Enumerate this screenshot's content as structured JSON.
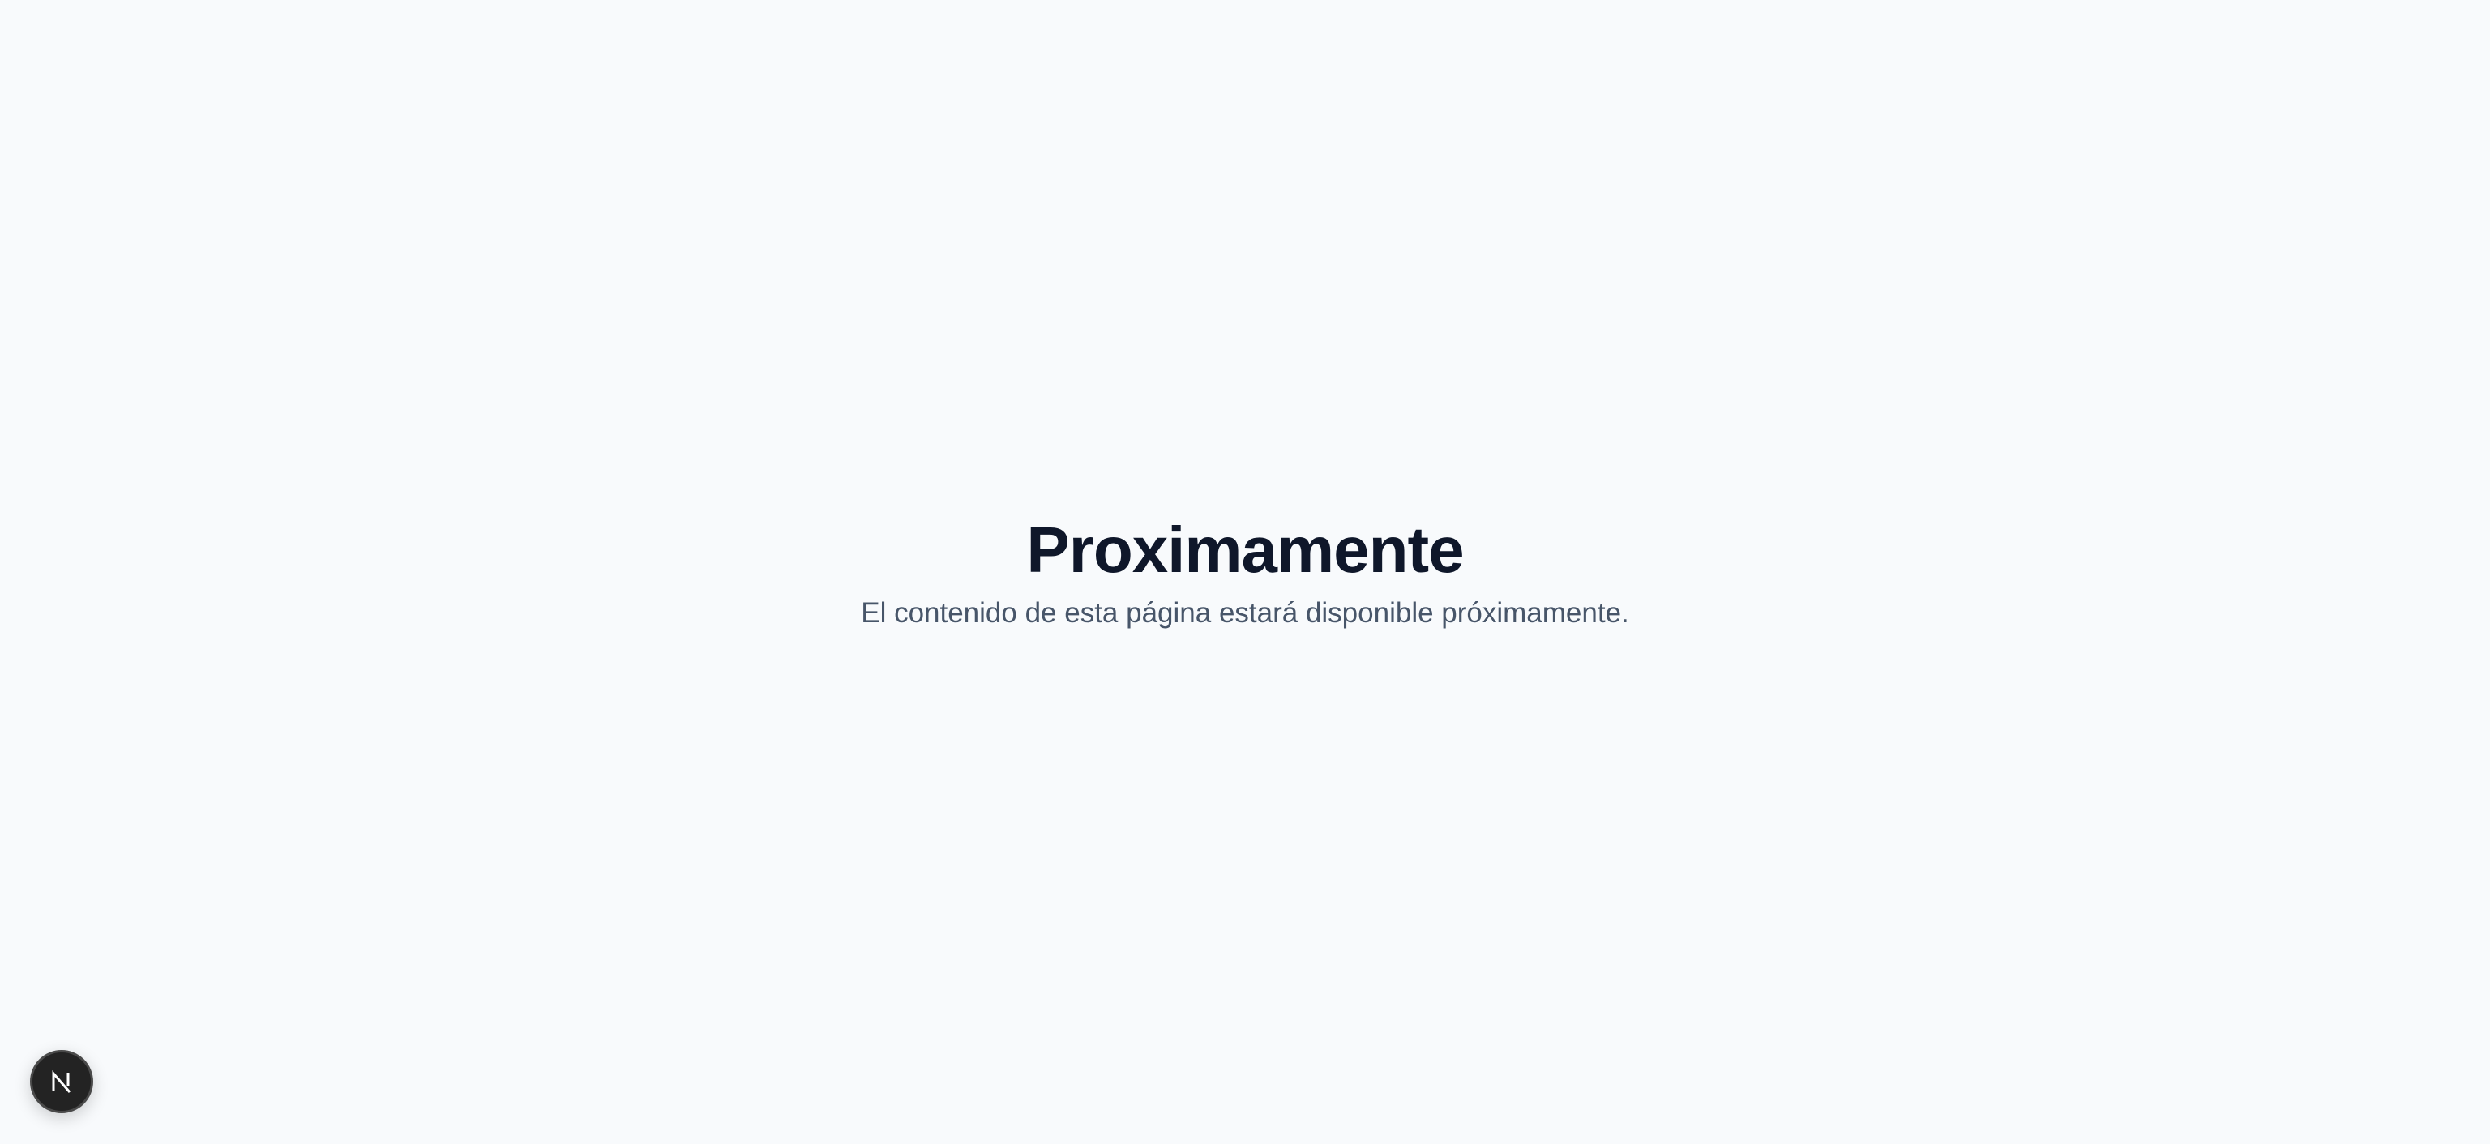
{
  "main": {
    "title": "Proximamente",
    "subtitle": "El contenido de esta página estará disponible próximamente."
  },
  "dev_indicator": {
    "icon": "nextjs-logo-icon",
    "label": "N"
  },
  "colors": {
    "background": "#f8fafc",
    "title": "#0f172a",
    "subtitle": "#475569",
    "badge": "#232323"
  }
}
